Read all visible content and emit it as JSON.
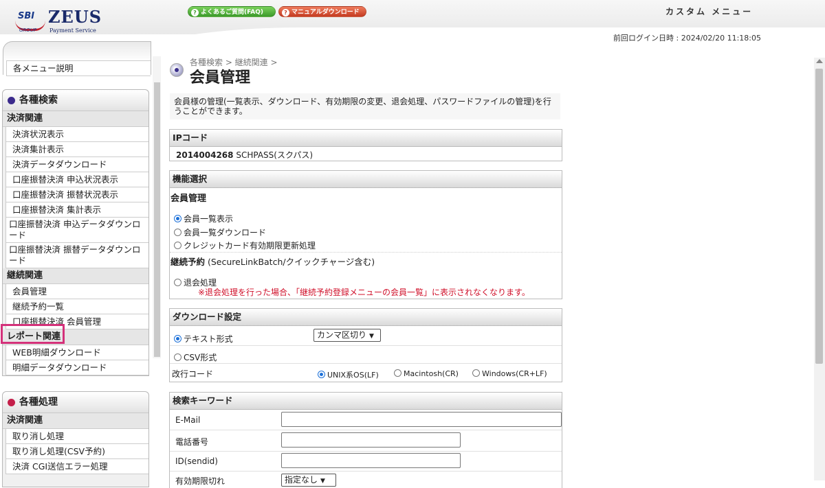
{
  "header": {
    "logo_sbi": "SBI",
    "logo_group": "GROUP",
    "logo_brand": "ZEUS",
    "logo_tagline": "Payment Service",
    "faq_label": "よくあるご質問(FAQ)",
    "manual_label": "マニュアルダウンロード",
    "custom_menu": "カスタム メニュー",
    "last_login": "前回ログイン日時 : 2024/02/20 11:18:05"
  },
  "sidebar": {
    "top_item": "各メニュー説明",
    "search_section": {
      "title": "各種検索",
      "dot_color": "#3b2a8c",
      "groups": [
        {
          "category": "決済関連",
          "items": [
            "決済状況表示",
            "決済集計表示",
            "決済データダウンロード",
            "口座振替決済 申込状況表示",
            "口座振替決済 振替状況表示",
            "口座振替決済 集計表示",
            "口座振替決済 申込データダウンロード",
            "口座振替決済 振替データダウンロード"
          ]
        },
        {
          "category": "継続関連",
          "items": [
            "会員管理",
            "継続予約一覧",
            "口座振替決済 会員管理"
          ]
        },
        {
          "category": "レポート関連",
          "items": [
            "WEB明細ダウンロード",
            "明細データダウンロード"
          ]
        }
      ]
    },
    "process_section": {
      "title": "各種処理",
      "dot_color": "#c41f4a",
      "category": "決済関連",
      "items": [
        "取り消し処理",
        "取り消し処理(CSV予約)",
        "決済 CGI送信エラー処理"
      ]
    }
  },
  "main": {
    "breadcrumb": "各種検索 > 継続関連 >",
    "title": "会員管理",
    "description": "会員様の管理(一覧表示、ダウンロード、有効期限の変更、退会処理、パスワードファイルの管理)を行うことができます。",
    "ip_panel": {
      "title": "IPコード",
      "code": "2014004268",
      "name": "SCHPASS(スクパス)"
    },
    "function_panel": {
      "title": "機能選択",
      "member_heading": "会員管理",
      "options": [
        "会員一覧表示",
        "会員一覧ダウンロード",
        "クレジットカード有効期限更新処理"
      ],
      "selected": "会員一覧表示",
      "continuation_heading": "継続予約",
      "continuation_note": "(SecureLinkBatch/クイックチャージ含む)",
      "withdraw_option": "退会処理",
      "withdraw_warning": "※退会処理を行った場合、「継続予約登録メニューの会員一覧」に表示されなくなります。",
      "warning_color": "#d0102a"
    },
    "download_panel": {
      "title": "ダウンロード設定",
      "text_format": "テキスト形式",
      "delimiter_value": "カンマ区切り",
      "csv_format": "CSV形式",
      "newline_label": "改行コード",
      "newline_options": [
        "UNIX系OS(LF)",
        "Macintosh(CR)",
        "Windows(CR+LF)"
      ],
      "newline_selected": "UNIX系OS(LF)"
    },
    "search_panel": {
      "title": "検索キーワード",
      "email_label": "E-Mail",
      "phone_label": "電話番号",
      "id_label": "ID(sendid)",
      "expiry_label": "有効期限切れ",
      "expiry_value": "指定なし"
    }
  }
}
